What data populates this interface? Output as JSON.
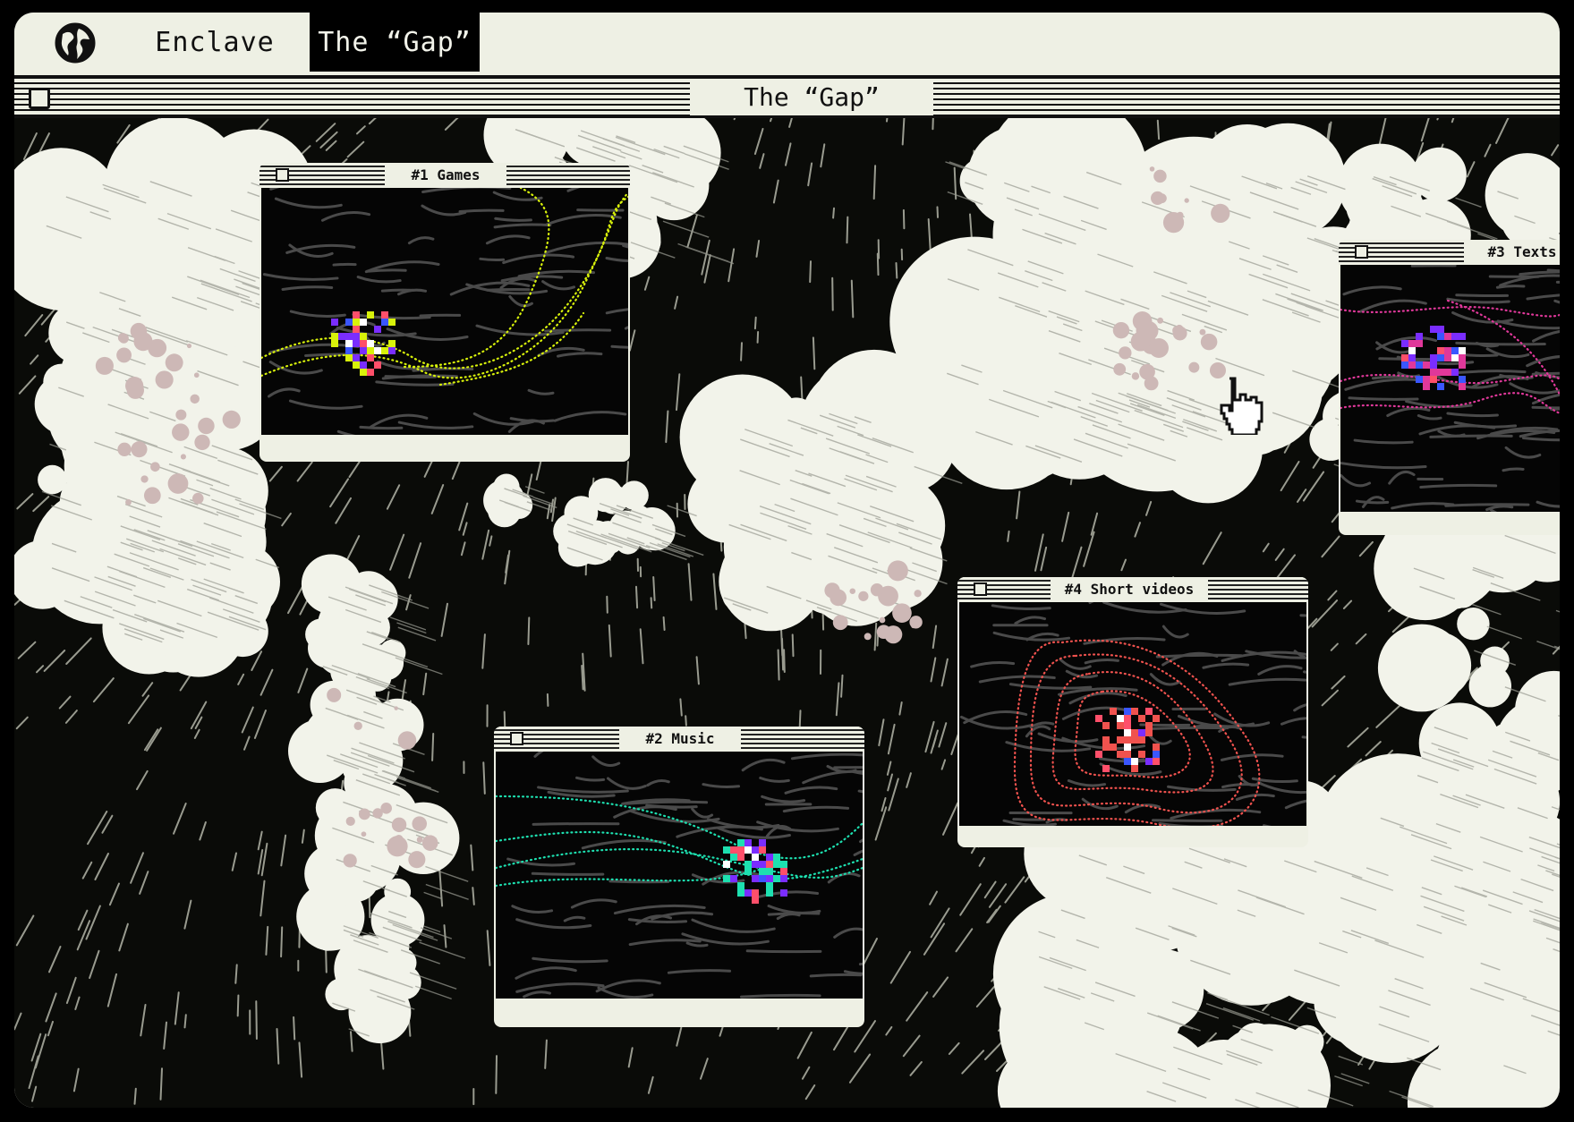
{
  "tabs": [
    {
      "label": "Enclave",
      "icon": "globe-icon",
      "active": false
    },
    {
      "label": "The “Gap”",
      "active": true
    }
  ],
  "window": {
    "title": "The “Gap”"
  },
  "windows": [
    {
      "title": "#1 Games",
      "accent": "#d8f20a"
    },
    {
      "title": "#2 Music",
      "accent": "#1de0b0"
    },
    {
      "title": "#3 Texts",
      "accent": "#e0389a"
    },
    {
      "title": "#4 Short videos",
      "accent": "#f0524e"
    }
  ],
  "colors": {
    "background": "#0a0b08",
    "land": "#f2f3ea",
    "chrome": "#eef0e4",
    "dots": "#cdb8b6"
  },
  "cursor": {
    "icon": "hand-pointer-icon"
  }
}
